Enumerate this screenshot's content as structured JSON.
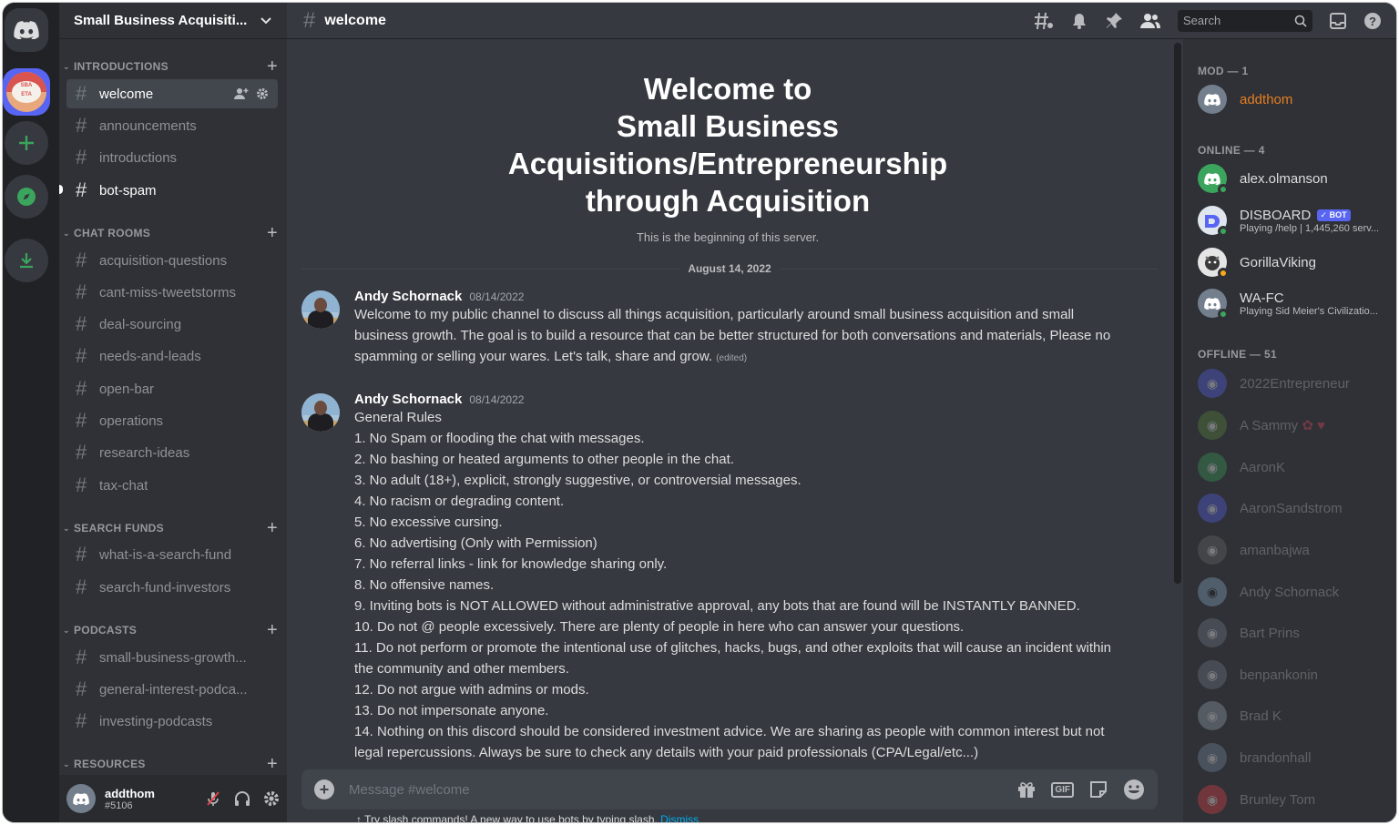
{
  "server": {
    "name": "Small Business Acquisiti...",
    "icon_text_top": "SBA",
    "icon_text_bottom": "ETA"
  },
  "categories": [
    {
      "label": "INTRODUCTIONS",
      "channels": [
        "welcome",
        "announcements",
        "introductions",
        "bot-spam"
      ]
    },
    {
      "label": "CHAT ROOMS",
      "channels": [
        "acquisition-questions",
        "cant-miss-tweetstorms",
        "deal-sourcing",
        "needs-and-leads",
        "open-bar",
        "operations",
        "research-ideas",
        "tax-chat"
      ]
    },
    {
      "label": "SEARCH FUNDS",
      "channels": [
        "what-is-a-search-fund",
        "search-fund-investors"
      ]
    },
    {
      "label": "PODCASTS",
      "channels": [
        "small-business-growth...",
        "general-interest-podca...",
        "investing-podcasts"
      ]
    },
    {
      "label": "RESOURCES",
      "channels": []
    }
  ],
  "user": {
    "name": "addthom",
    "tag": "#5106"
  },
  "channel": {
    "name": "welcome"
  },
  "search": {
    "placeholder": "Search"
  },
  "welcome": {
    "title_lines": [
      "Welcome to",
      "Small Business",
      "Acquisitions/Entrepreneurship",
      "through Acquisition"
    ],
    "subtitle": "This is the beginning of this server."
  },
  "date_divider": "August 14, 2022",
  "messages": [
    {
      "author": "Andy Schornack",
      "timestamp": "08/14/2022",
      "text": "Welcome to my public channel to discuss all things acquisition, particularly around small business acquisition and small business growth.  The goal is to build a resource that can be better structured for both conversations and materials, Please no spamming or selling your wares. Let's talk, share and grow.",
      "edited": "(edited)"
    },
    {
      "author": "Andy Schornack",
      "timestamp": "08/14/2022",
      "heading": "General Rules",
      "rules": [
        "1. No Spam or flooding the chat with messages.",
        "2. No bashing or heated arguments to other people in the chat.",
        "3. No adult (18+), explicit, strongly suggestive, or controversial messages.",
        "4. No racism or degrading content.",
        "5. No excessive cursing.",
        "6. No advertising (Only with Permission)",
        "7. No referral links - link for knowledge sharing only.",
        "8.  No offensive names.",
        "9. Inviting bots is NOT ALLOWED without administrative approval, any bots that are found will be INSTANTLY BANNED.",
        "10. Do not @ people excessively. There are plenty of people in here who can answer your questions.",
        "11. Do not perform or promote the intentional use of glitches, hacks, bugs, and other exploits that will cause an incident within the community and other members.",
        "12. Do not argue with admins or mods.",
        "13. Do not impersonate anyone.",
        "14. Nothing on this discord should be considered investment advice. We are sharing as people with common interest but not legal repercussions. Always be sure to check any details with your paid professionals (CPA/Legal/etc...)"
      ]
    }
  ],
  "composer": {
    "placeholder": "Message #welcome",
    "gif_label": "GIF",
    "tip": "Try slash commands! A new way to use bots by typing slash.",
    "tip_dismiss": "Dismiss"
  },
  "members": {
    "mod_header": "MOD — 1",
    "online_header": "ONLINE — 4",
    "offline_header": "OFFLINE — 51",
    "mod": [
      {
        "name": "addthom"
      }
    ],
    "online": [
      {
        "name": "alex.olmanson",
        "activity": ""
      },
      {
        "name": "DISBOARD",
        "bot_label": "BOT",
        "activity": "Playing /help | 1,445,260 serv..."
      },
      {
        "name": "GorillaViking",
        "activity": ""
      },
      {
        "name": "WA-FC",
        "activity": "Playing Sid Meier's Civilizatio..."
      }
    ],
    "offline": [
      "2022Entrepreneur",
      "A Sammy",
      "AaronK",
      "AaronSandstrom",
      "amanbajwa",
      "Andy Schornack",
      "Bart Prins",
      "benpankonin",
      "Brad K",
      "brandonhall",
      "Brunley Tom"
    ]
  },
  "colors": {
    "accent": "#5865f2",
    "online": "#3ba55d",
    "mod_name": "#e67e22",
    "link": "#00aff4"
  }
}
